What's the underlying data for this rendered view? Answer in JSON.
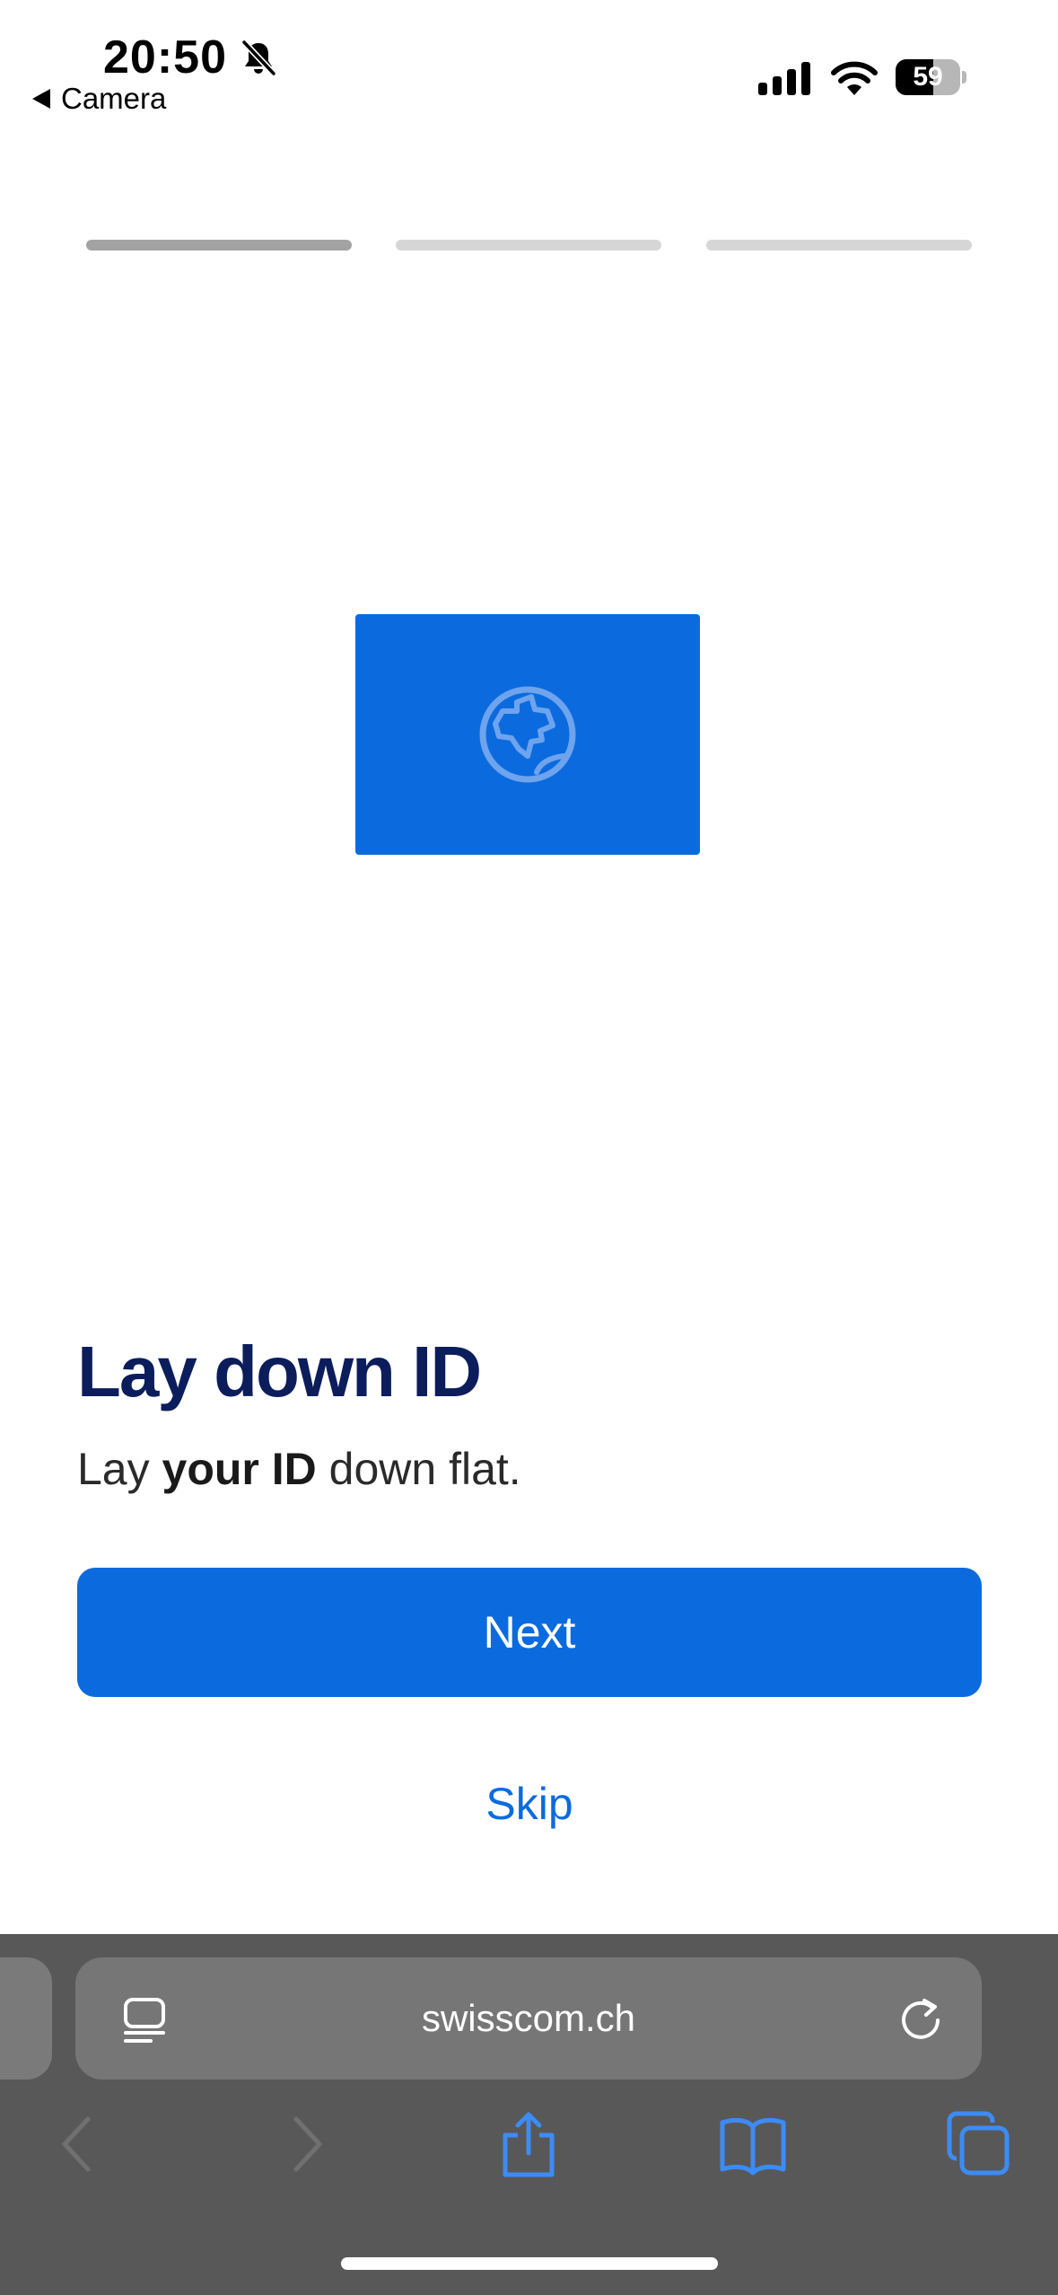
{
  "status_bar": {
    "time": "20:50",
    "back_app": "Camera",
    "battery": "59",
    "battery_level": 0.59
  },
  "steps": {
    "total": 3,
    "current": 1
  },
  "content": {
    "title": "Lay down ID",
    "instruction_pre": "Lay ",
    "instruction_bold": "your ID",
    "instruction_post": " down flat."
  },
  "buttons": {
    "next": "Next",
    "skip": "Skip"
  },
  "browser": {
    "url": "swisscom.ch"
  },
  "icons": {
    "mute": "bell-slash-icon",
    "signal": "cellular-signal-icon",
    "wifi": "wifi-icon",
    "card": "globe-icon",
    "reader": "reader-mode-icon",
    "reload": "reload-icon",
    "back": "chevron-left-icon",
    "forward": "chevron-right-icon",
    "share": "share-icon",
    "bookmarks": "book-icon",
    "tabs": "tabs-icon"
  },
  "colors": {
    "accent": "#0b6bde",
    "title": "#0c1d5c",
    "toolbar": "#585858",
    "nav_active": "#3d8bf5",
    "nav_disabled": "#707070"
  }
}
